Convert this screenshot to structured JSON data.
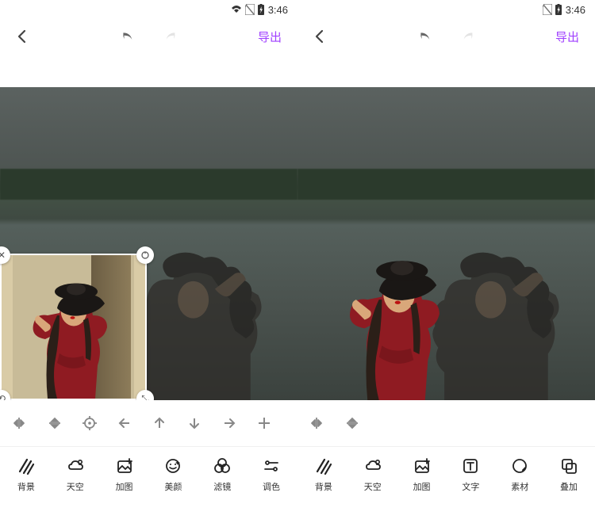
{
  "status": {
    "time": "3:46"
  },
  "nav": {
    "export": "导出"
  },
  "toolsLeft": [
    {
      "key": "bg",
      "label": "背景"
    },
    {
      "key": "sky",
      "label": "天空"
    },
    {
      "key": "addimg",
      "label": "加图"
    },
    {
      "key": "beauty",
      "label": "美颜"
    },
    {
      "key": "filter",
      "label": "滤镜"
    },
    {
      "key": "color",
      "label": "调色"
    }
  ],
  "toolsRight": [
    {
      "key": "bg",
      "label": "背景"
    },
    {
      "key": "sky",
      "label": "天空"
    },
    {
      "key": "addimg",
      "label": "加图"
    },
    {
      "key": "text",
      "label": "文字"
    },
    {
      "key": "sticker",
      "label": "素材"
    },
    {
      "key": "overlay",
      "label": "叠加"
    }
  ]
}
